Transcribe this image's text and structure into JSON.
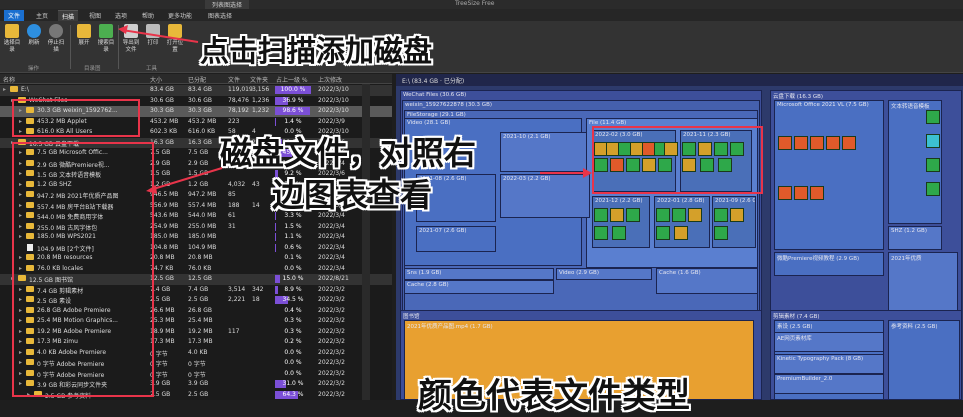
{
  "titlebar": {
    "context_tab": "列表图选择",
    "title": "TreeSize Free"
  },
  "ribbon_tabs": [
    "文件",
    "主页",
    "扫描",
    "视图",
    "选项",
    "帮助",
    "更多功能",
    "图表选择"
  ],
  "ribbon": {
    "buttons": [
      {
        "label": "选择目录"
      },
      {
        "label": "刷新"
      },
      {
        "label": "停止扫描"
      },
      {
        "label": "展开"
      },
      {
        "label": "搜索目录"
      },
      {
        "label": "导出到文件"
      },
      {
        "label": "打印"
      },
      {
        "label": "打开位置"
      }
    ],
    "groups": [
      "操作",
      "目录图",
      "工具"
    ]
  },
  "annotations": {
    "scan_add": "点击扫描添加磁盘",
    "compare": "磁盘文件，对照右",
    "compare2": "边图表查看",
    "color_type": "颜色代表文件类型"
  },
  "columns": [
    "名称",
    "大小",
    "已分配",
    "文件",
    "文件夹",
    "占上一级 %",
    "上次修改"
  ],
  "rows": [
    {
      "name": "E:\\",
      "size": "83.4 GB",
      "alloc": "83.4 GB",
      "files": "119,019",
      "folders": "3,156",
      "pct": "100.0 %",
      "pv": 100,
      "date": "2022/3/10",
      "level": 0,
      "type": "folder",
      "cls": "sel"
    },
    {
      "name": "WeChat Files",
      "size": "30.6 GB",
      "alloc": "30.6 GB",
      "files": "78,476",
      "folders": "1,236",
      "pct": "36.9 %",
      "pv": 37,
      "date": "2022/3/10",
      "level": 1,
      "type": "folder",
      "cls": ""
    },
    {
      "name": "30.3 GB  weixin_1592762...",
      "size": "30.3 GB",
      "alloc": "30.3 GB",
      "files": "78,192",
      "folders": "1,232",
      "pct": "98.6 %",
      "pv": 98,
      "date": "2022/3/10",
      "level": 2,
      "type": "folder",
      "cls": "hi"
    },
    {
      "name": "453.2 MB  Applet",
      "size": "453.2 MB",
      "alloc": "453.2 MB",
      "files": "223",
      "folders": "",
      "pct": "1.4 %",
      "pv": 1,
      "date": "2022/3/9",
      "level": 2,
      "type": "folder",
      "cls": ""
    },
    {
      "name": "616.0 KB  All Users",
      "size": "602.3 KB",
      "alloc": "616.0 KB",
      "files": "58",
      "folders": "4",
      "pct": "0.0 %",
      "pv": 0,
      "date": "2022/3/10",
      "level": 2,
      "type": "folder",
      "cls": ""
    },
    {
      "name": "16.3 GB  云盘下载",
      "size": "16.3 GB",
      "alloc": "16.3 GB",
      "files": "5,578",
      "folders": "254",
      "pct": "19.6 %",
      "pv": 20,
      "date": "2022/3/6",
      "level": 1,
      "type": "folder",
      "cls": "sel"
    },
    {
      "name": "7.5 GB  Microsoft Offic...",
      "size": "7.5 GB",
      "alloc": "7.5 GB",
      "files": "39",
      "folders": "6",
      "pct": "45.8 %",
      "pv": 46,
      "date": "2022/3/6",
      "level": 2,
      "type": "folder",
      "cls": ""
    },
    {
      "name": "2.9 GB  微酷Premiere视...",
      "size": "2.9 GB",
      "alloc": "2.9 GB",
      "files": "",
      "folders": "",
      "pct": "17.6 %",
      "pv": 18,
      "date": "2022/3/4",
      "level": 2,
      "type": "folder",
      "cls": ""
    },
    {
      "name": "1.5 GB  文本转语音模板",
      "size": "1.5 GB",
      "alloc": "1.5 GB",
      "files": "",
      "folders": "",
      "pct": "9.2 %",
      "pv": 9,
      "date": "2022/3/6",
      "level": 2,
      "type": "folder",
      "cls": ""
    },
    {
      "name": "1.2 GB  SHZ",
      "size": "1.2 GB",
      "alloc": "1.2 GB",
      "files": "4,032",
      "folders": "43",
      "pct": "7.6 %",
      "pv": 8,
      "date": "2022/3/4",
      "level": 2,
      "type": "folder",
      "cls": ""
    },
    {
      "name": "947.2 MB  2021年优质产品图",
      "size": "946.5 MB",
      "alloc": "947.2 MB",
      "files": "85",
      "folders": "",
      "pct": "5.7 %",
      "pv": 6,
      "date": "2022/3/4",
      "level": 2,
      "type": "folder",
      "cls": ""
    },
    {
      "name": "557.4 MB  房平台B站下载器",
      "size": "556.9 MB",
      "alloc": "557.4 MB",
      "files": "188",
      "folders": "14",
      "pct": "3.3 %",
      "pv": 3,
      "date": "2022/3/4",
      "level": 2,
      "type": "folder",
      "cls": ""
    },
    {
      "name": "544.0 MB  免费商用字体",
      "size": "543.6 MB",
      "alloc": "544.0 MB",
      "files": "61",
      "folders": "",
      "pct": "3.3 %",
      "pv": 3,
      "date": "2022/3/4",
      "level": 2,
      "type": "folder",
      "cls": ""
    },
    {
      "name": "255.0 MB  古风字体包",
      "size": "254.9 MB",
      "alloc": "255.0 MB",
      "files": "31",
      "folders": "",
      "pct": "1.5 %",
      "pv": 2,
      "date": "2022/3/4",
      "level": 2,
      "type": "folder",
      "cls": ""
    },
    {
      "name": "185.0 MB  WPS2021",
      "size": "185.0 MB",
      "alloc": "185.0 MB",
      "files": "",
      "folders": "",
      "pct": "1.1 %",
      "pv": 1,
      "date": "2022/3/4",
      "level": 2,
      "type": "folder",
      "cls": ""
    },
    {
      "name": "104.9 MB  [2个文件]",
      "size": "104.8 MB",
      "alloc": "104.9 MB",
      "files": "",
      "folders": "",
      "pct": "0.6 %",
      "pv": 1,
      "date": "2022/3/4",
      "level": 2,
      "type": "file",
      "cls": ""
    },
    {
      "name": "20.8 MB  resources",
      "size": "20.8 MB",
      "alloc": "20.8 MB",
      "files": "",
      "folders": "",
      "pct": "0.1 %",
      "pv": 0,
      "date": "2022/3/4",
      "level": 2,
      "type": "folder",
      "cls": ""
    },
    {
      "name": "76.0 KB  locales",
      "size": "74.7 KB",
      "alloc": "76.0 KB",
      "files": "",
      "folders": "",
      "pct": "0.0 %",
      "pv": 0,
      "date": "2022/3/4",
      "level": 2,
      "type": "folder",
      "cls": ""
    },
    {
      "name": "12.5 GB  图书馆",
      "size": "12.5 GB",
      "alloc": "12.5 GB",
      "files": "",
      "folders": "",
      "pct": "15.0 %",
      "pv": 15,
      "date": "2022/8/21",
      "level": 1,
      "type": "folder",
      "cls": "sel"
    },
    {
      "name": "7.4 GB  剪辑素材",
      "size": "7.4 GB",
      "alloc": "7.4 GB",
      "files": "3,514",
      "folders": "342",
      "pct": "8.9 %",
      "pv": 9,
      "date": "2022/3/2",
      "level": 2,
      "type": "folder",
      "cls": ""
    },
    {
      "name": "2.5 GB  素设",
      "size": "2.5 GB",
      "alloc": "2.5 GB",
      "files": "2,221",
      "folders": "18",
      "pct": "34.5 %",
      "pv": 35,
      "date": "2022/3/2",
      "level": 2,
      "type": "folder",
      "cls": ""
    },
    {
      "name": "26.8 GB  Adobe Premiere",
      "size": "26.6 MB",
      "alloc": "26.8 GB",
      "files": "",
      "folders": "",
      "pct": "0.4 %",
      "pv": 0,
      "date": "2022/3/2",
      "level": 2,
      "type": "folder",
      "cls": ""
    },
    {
      "name": "25.4 MB  Motion Graphics...",
      "size": "25.3 MB",
      "alloc": "25.4 MB",
      "files": "",
      "folders": "",
      "pct": "0.3 %",
      "pv": 0,
      "date": "2022/3/2",
      "level": 2,
      "type": "folder",
      "cls": ""
    },
    {
      "name": "19.2 MB  Adobe Premiere",
      "size": "18.9 MB",
      "alloc": "19.2 MB",
      "files": "117",
      "folders": "",
      "pct": "0.3 %",
      "pv": 0,
      "date": "2022/3/2",
      "level": 2,
      "type": "folder",
      "cls": ""
    },
    {
      "name": "17.3 MB  zimu",
      "size": "17.3 MB",
      "alloc": "17.3 MB",
      "files": "",
      "folders": "",
      "pct": "0.2 %",
      "pv": 0,
      "date": "2022/3/2",
      "level": 2,
      "type": "folder",
      "cls": ""
    },
    {
      "name": "4.0 KB  Adobe Premiere",
      "size": "0 字节",
      "alloc": "4.0 KB",
      "files": "",
      "folders": "",
      "pct": "0.0 %",
      "pv": 0,
      "date": "2022/3/2",
      "level": 2,
      "type": "folder",
      "cls": ""
    },
    {
      "name": "0 字节  Adobe Premiere",
      "size": "0 字节",
      "alloc": "0 字节",
      "files": "",
      "folders": "",
      "pct": "0.0 %",
      "pv": 0,
      "date": "2022/3/2",
      "level": 2,
      "type": "folder",
      "cls": ""
    },
    {
      "name": "0 字节  Adobe Premiere",
      "size": "0 字节",
      "alloc": "0 字节",
      "files": "",
      "folders": "",
      "pct": "0.0 %",
      "pv": 0,
      "date": "2022/3/2",
      "level": 2,
      "type": "folder",
      "cls": ""
    },
    {
      "name": "3.9 GB  和彩云同步文件夹",
      "size": "3.9 GB",
      "alloc": "3.9 GB",
      "files": "",
      "folders": "",
      "pct": "31.0 %",
      "pv": 31,
      "date": "2022/3/2",
      "level": 2,
      "type": "folder",
      "cls": ""
    },
    {
      "name": "2.5 GB  参考资料",
      "size": "2.5 GB",
      "alloc": "2.5 GB",
      "files": "",
      "folders": "",
      "pct": "64.3 %",
      "pv": 64,
      "date": "2022/3/2",
      "level": 3,
      "type": "folder",
      "cls": ""
    }
  ],
  "treemap": {
    "header": "E:\\ (83.4 GB · 已分配)",
    "blocks": [
      {
        "label": "WeChat Files (30.6 GB)"
      },
      {
        "label": "weixin_15927622878 (30.3 GB)"
      },
      {
        "label": "FileStorage (29.1 GB)"
      },
      {
        "label": "Video (28.1 GB)"
      },
      {
        "label": "2021-10 (2.1 GB)"
      },
      {
        "label": "File (11.4 GB)"
      },
      {
        "label": "2022-02 (3.0 GB)"
      },
      {
        "label": "2021-11 (2.3 GB)"
      },
      {
        "label": "2021-12 (2.2 GB)"
      },
      {
        "label": "2022-01 (2.8 GB)"
      },
      {
        "label": "2021-09 (2.6 GB)"
      },
      {
        "label": "2022-03 (2.2 GB)"
      },
      {
        "label": "2021-08 (2.6 GB)"
      },
      {
        "label": "2021-07 (2.6 GB)"
      },
      {
        "label": "Sns (1.9 GB)"
      },
      {
        "label": "Video (2.9 GB)"
      },
      {
        "label": "Cache (2.8 GB)"
      },
      {
        "label": "Cache (1.6 GB)"
      },
      {
        "label": "云盘下载 (16.3 GB)"
      },
      {
        "label": "Microsoft Office 2021 VL (7.5 GB)"
      },
      {
        "label": "文本转语音模板"
      },
      {
        "label": "SHZ (1.2 GB)"
      },
      {
        "label": "微酷Premiere视频教程 (2.9 GB)"
      },
      {
        "label": "2021年优质"
      },
      {
        "label": "图书馆"
      },
      {
        "label": "2021年优质产品图.mp4 (1.7 GB)"
      },
      {
        "label": "剪辑素材 (7.4 GB)"
      },
      {
        "label": "素设 (2.5 GB)"
      },
      {
        "label": "AE网页素材库"
      },
      {
        "label": "Kinetic Typography Pack (8 GB)"
      },
      {
        "label": "PremiumBuilder_2.0"
      },
      {
        "label": "参考资料 (2.5 GB)"
      }
    ]
  }
}
